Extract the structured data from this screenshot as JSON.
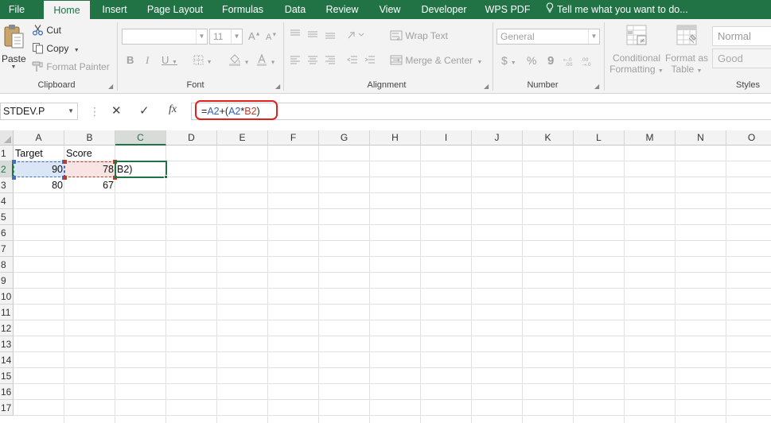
{
  "tabs": [
    {
      "label": "File"
    },
    {
      "label": "Home",
      "active": true
    },
    {
      "label": "Insert"
    },
    {
      "label": "Page Layout"
    },
    {
      "label": "Formulas"
    },
    {
      "label": "Data"
    },
    {
      "label": "Review"
    },
    {
      "label": "View"
    },
    {
      "label": "Developer"
    },
    {
      "label": "WPS PDF"
    }
  ],
  "tell_me": "Tell me what you want to do...",
  "clipboard": {
    "paste": "Paste",
    "cut": "Cut",
    "copy": "Copy",
    "format_painter": "Format Painter",
    "label": "Clipboard"
  },
  "font": {
    "size": "11",
    "bold": "B",
    "italic": "I",
    "underline": "U",
    "label": "Font"
  },
  "alignment": {
    "wrap_text": "Wrap Text",
    "merge_center": "Merge & Center",
    "label": "Alignment"
  },
  "number": {
    "format": "General",
    "currency": "$",
    "percent": "%",
    "comma": "9",
    "label": "Number"
  },
  "styles": {
    "conditional_line1": "Conditional",
    "conditional_line2": "Formatting",
    "format_table_line1": "Format as",
    "format_table_line2": "Table",
    "normal": "Normal",
    "good": "Good",
    "label": "Styles"
  },
  "formula_bar": {
    "name_box": "STDEV.P",
    "cancel": "✕",
    "enter": "✓",
    "fx": "fx",
    "formula": {
      "p1": "=",
      "p2": "A2",
      "p3": "+(",
      "p4": "A2",
      "p5": "*",
      "p6": "B2",
      "p7": ")"
    }
  },
  "columns": [
    "A",
    "B",
    "C",
    "D",
    "E",
    "F",
    "G",
    "H",
    "I",
    "J",
    "K",
    "L",
    "M",
    "N",
    "O"
  ],
  "rows": [
    "1",
    "2",
    "3",
    "4",
    "5",
    "6",
    "7",
    "8",
    "9",
    "10",
    "11",
    "12",
    "13",
    "14",
    "15",
    "16",
    "17"
  ],
  "cells": {
    "A1": "Target",
    "B1": "Score",
    "A2": "90",
    "B2": "78",
    "C2": "B2)",
    "A3": "80",
    "B3": "67"
  },
  "colors": {
    "accent": "#217346",
    "ref_a": "#2f5fb8",
    "ref_b": "#c0392b",
    "highlight": "#e02020"
  }
}
